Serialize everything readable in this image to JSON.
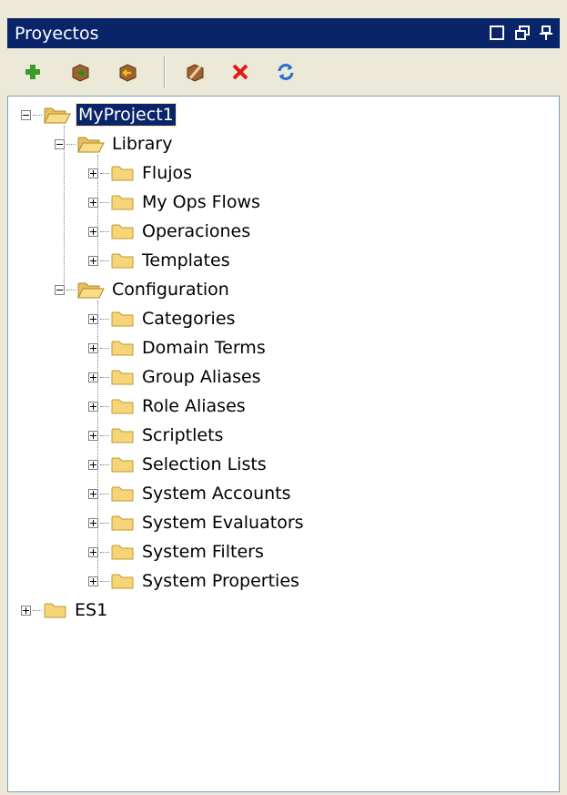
{
  "panel": {
    "title": "Proyectos"
  },
  "titlebar_icons": [
    "minimize-icon",
    "restore-icon",
    "pin-icon"
  ],
  "toolbar": {
    "tools": [
      "add-icon",
      "import-icon",
      "export-icon",
      "edit-icon",
      "delete-icon",
      "refresh-icon"
    ]
  },
  "tree": {
    "project1": "MyProject1",
    "library": "Library",
    "library_items": [
      "Flujos",
      "My Ops Flows",
      "Operaciones",
      "Templates"
    ],
    "configuration": "Configuration",
    "configuration_items": [
      "Categories",
      "Domain Terms",
      "Group Aliases",
      "Role Aliases",
      "Scriptlets",
      "Selection Lists",
      "System Accounts",
      "System Evaluators",
      "System Filters",
      "System Properties"
    ],
    "project2": "ES1"
  },
  "colors": {
    "titlebar": "#0a246a",
    "selection": "#0a246a",
    "folder": "#f5d577",
    "tree_background": "#ffffff"
  }
}
